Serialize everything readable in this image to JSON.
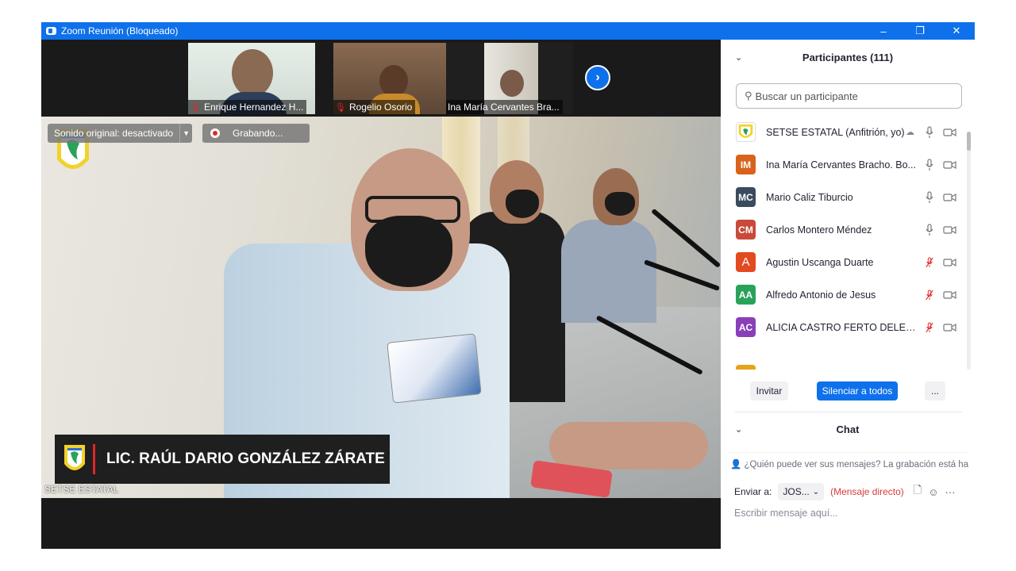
{
  "window": {
    "title": "Zoom Reunión (Bloqueado)",
    "minimize": "–",
    "restore": "❐",
    "close": "✕"
  },
  "thumbnails": [
    {
      "name": "Enrique Hernandez H...",
      "muted": true
    },
    {
      "name": "Rogelio Osorio",
      "muted": true
    },
    {
      "name": "Ina María Cervantes Bra...",
      "muted": false
    }
  ],
  "next_page_icon": "chevron-right",
  "main_video": {
    "speaker_banner": "LIC. RAÚL DARIO GONZÁLEZ ZÁRATE",
    "self_label": "SETSE ESTATAL",
    "audio_status": "Sonido original: desactivado",
    "recording": "Grabando..."
  },
  "participants": {
    "header": "Participantes (111)",
    "search_placeholder": "Buscar un participante",
    "list": [
      {
        "initials": "",
        "name": "SETSE ESTATAL (Anfitrión, yo)",
        "color": "#ffffff",
        "cloud": true,
        "mic_muted": false
      },
      {
        "initials": "IM",
        "name": "Ina María Cervantes Bracho. Bo...",
        "color": "#d9621c",
        "cloud": false,
        "mic_muted": false
      },
      {
        "initials": "MC",
        "name": "Mario Caliz Tiburcio",
        "color": "#3b4b5e",
        "cloud": false,
        "mic_muted": false
      },
      {
        "initials": "CM",
        "name": "Carlos Montero  Méndez",
        "color": "#c94a3a",
        "cloud": false,
        "mic_muted": false
      },
      {
        "initials": "A",
        "name": "Agustin Uscanga Duarte",
        "color": "#e24a1f",
        "cloud": false,
        "mic_muted": true
      },
      {
        "initials": "AA",
        "name": "Alfredo Antonio de Jesus",
        "color": "#2aa35a",
        "cloud": false,
        "mic_muted": true
      },
      {
        "initials": "AC",
        "name": "ALICIA CASTRO FERTO DELEGAC...",
        "color": "#8a3fb8",
        "cloud": false,
        "mic_muted": true
      }
    ],
    "buttons": {
      "invite": "Invitar",
      "mute_all": "Silenciar a todos",
      "more": "..."
    }
  },
  "chat": {
    "header": "Chat",
    "notice": "¿Quién puede ver sus mensajes? La grabación está habilit",
    "send_to_label": "Enviar a:",
    "recipient": "JOS...",
    "recipient_type": "(Mensaje directo)",
    "input_placeholder": "Escribir mensaje aquí..."
  },
  "colors": {
    "zoom_blue": "#0e71eb",
    "muted_red": "#e02828"
  }
}
